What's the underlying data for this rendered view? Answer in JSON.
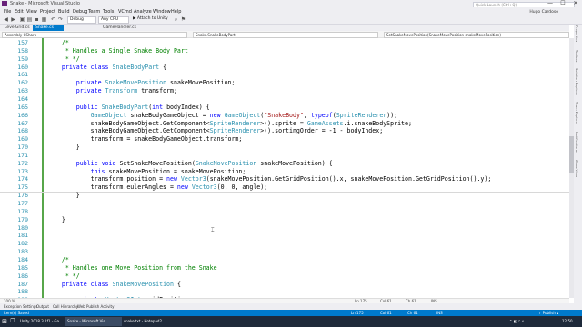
{
  "window": {
    "title": "Snake - Microsoft Visual Studio",
    "minimize": "—",
    "maximize": "☐",
    "close": "✕"
  },
  "menu": [
    "File",
    "Edit",
    "View",
    "Project",
    "Build",
    "Debug",
    "Team",
    "Tools",
    "VCmd",
    "Analyze",
    "Window",
    "Help"
  ],
  "toolbar": {
    "config": "Debug",
    "platform": "Any CPU",
    "attach": "▶ Attach to Unity"
  },
  "search": {
    "placeholder": "Quick Launch (Ctrl+Q)"
  },
  "account": "Hugo Cardoso",
  "tabs": [
    {
      "label": "LevelGrid.cs",
      "active": false
    },
    {
      "label": "Snake.cs",
      "active": true
    },
    {
      "label": "GameHandler.cs",
      "active": false
    }
  ],
  "nav": {
    "project": "Assembly-CSharp",
    "class": "Snake.SnakeBodyPart",
    "member": "SetSnakeMovePosition(SnakeMovePosition snakeMovePosition)"
  },
  "right_tabs": [
    "Properties",
    "Toolbox",
    "Solution Explorer",
    "Team Explorer",
    "Notifications",
    "Class View"
  ],
  "code_lines": [
    {
      "n": "157",
      "code": "    /*"
    },
    {
      "n": "158",
      "code": "     * Handles a Single Snake Body Part"
    },
    {
      "n": "159",
      "code": "     * */"
    },
    {
      "n": "160",
      "code": "    private class SnakeBodyPart {"
    },
    {
      "n": "161",
      "code": ""
    },
    {
      "n": "162",
      "code": "        private SnakeMovePosition snakeMovePosition;"
    },
    {
      "n": "163",
      "code": "        private Transform transform;"
    },
    {
      "n": "164",
      "code": ""
    },
    {
      "n": "165",
      "code": "        public SnakeBodyPart(int bodyIndex) {"
    },
    {
      "n": "166",
      "code": "            GameObject snakeBodyGameObject = new GameObject(\"SnakeBody\", typeof(SpriteRenderer));"
    },
    {
      "n": "167",
      "code": "            snakeBodyGameObject.GetComponent<SpriteRenderer>().sprite = GameAssets.i.snakeBodySprite;"
    },
    {
      "n": "168",
      "code": "            snakeBodyGameObject.GetComponent<SpriteRenderer>().sortingOrder = -1 - bodyIndex;"
    },
    {
      "n": "169",
      "code": "            transform = snakeBodyGameObject.transform;"
    },
    {
      "n": "170",
      "code": "        }"
    },
    {
      "n": "171",
      "code": ""
    },
    {
      "n": "172",
      "code": "        public void SetSnakeMovePosition(SnakeMovePosition snakeMovePosition) {"
    },
    {
      "n": "173",
      "code": "            this.snakeMovePosition = snakeMovePosition;"
    },
    {
      "n": "174",
      "code": "            transform.position = new Vector3(snakeMovePosition.GetGridPosition().x, snakeMovePosition.GetGridPosition().y);"
    },
    {
      "n": "175",
      "code": "            transform.eulerAngles = new Vector3(0, 0, angle);"
    },
    {
      "n": "176",
      "code": "        }"
    },
    {
      "n": "177",
      "code": ""
    },
    {
      "n": "178",
      "code": ""
    },
    {
      "n": "179",
      "code": "    }"
    },
    {
      "n": "180",
      "code": ""
    },
    {
      "n": "181",
      "code": ""
    },
    {
      "n": "182",
      "code": ""
    },
    {
      "n": "183",
      "code": ""
    },
    {
      "n": "184",
      "code": "    /*"
    },
    {
      "n": "185",
      "code": "     * Handles one Move Position from the Snake"
    },
    {
      "n": "186",
      "code": "     * */"
    },
    {
      "n": "187",
      "code": "    private class SnakeMovePosition {"
    },
    {
      "n": "188",
      "code": ""
    },
    {
      "n": "189",
      "code": "        private Vector2Int gridPosition;"
    }
  ],
  "editor_status": {
    "zoom": "100 %",
    "ln": "Ln 175",
    "col": "Col 61",
    "ch": "Ch 61",
    "ins": "INS"
  },
  "output_tabs": [
    "Exception Settings",
    "Output",
    "Call Hierarchy",
    "Web Publish Activity"
  ],
  "status": {
    "message": "Item(s) Saved",
    "ln": "Ln 175",
    "col": "Col 61",
    "ch": "Ch 61",
    "ins": "INS",
    "publish": "↑ Publish ▴"
  },
  "taskbar": [
    {
      "label": "Unity 2018.3.1f1 - Ga...",
      "active": false
    },
    {
      "label": "Snake - Microsoft Vis...",
      "active": true
    },
    {
      "label": "snake.txt - Notepad2",
      "active": false
    }
  ],
  "systray": {
    "time": "12:50"
  },
  "colors": {
    "accent": "#007acc",
    "keyword": "#0000ff",
    "type": "#2b91af",
    "string": "#a31515",
    "comment": "#008000"
  }
}
